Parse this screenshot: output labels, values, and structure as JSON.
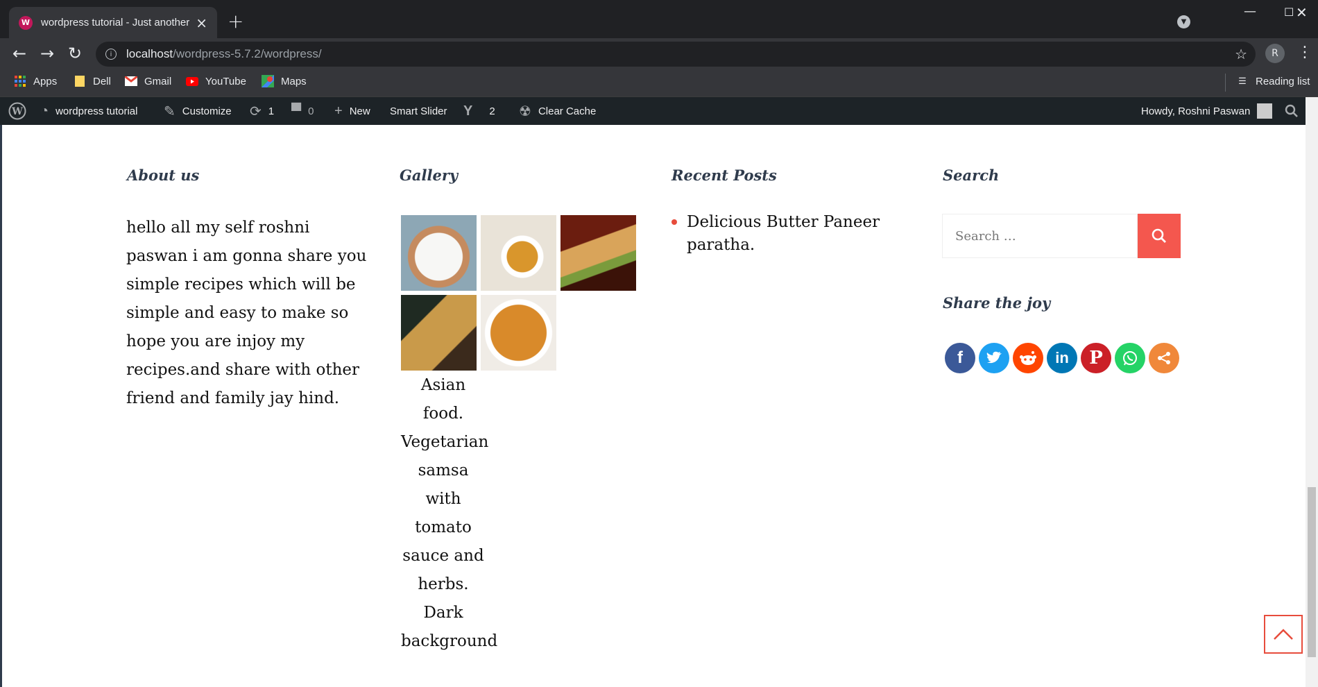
{
  "browser": {
    "tab_title": "wordpress tutorial - Just another",
    "url_host": "localhost",
    "url_path": "/wordpress-5.7.2/wordpress/",
    "profile_initial": "R",
    "bookmarks": [
      "Apps",
      "Dell",
      "Gmail",
      "YouTube",
      "Maps"
    ],
    "reading_list": "Reading list"
  },
  "adminbar": {
    "site_name": "wordpress tutorial",
    "customize": "Customize",
    "updates_count": "1",
    "comments_count": "0",
    "new": "New",
    "smart_slider": "Smart Slider",
    "yoast_count": "2",
    "clear_cache": "Clear Cache",
    "howdy": "Howdy, Roshni Paswan"
  },
  "widgets": {
    "about_title": "About us",
    "about_text": "hello all my self roshni paswan i am gonna share you simple recipes which will be simple and easy to make so hope you are injoy my recipes.and share with other friend and family jay hind.",
    "gallery_title": "Gallery",
    "gallery_caption": "Asian food. Vegetarian samsa with tomato sauce and herbs. Dark background",
    "recent_title": "Recent Posts",
    "recent_posts": [
      "Delicious Butter Paneer paratha."
    ],
    "search_title": "Search",
    "search_placeholder": "Search …",
    "share_title": "Share the joy"
  },
  "colors": {
    "accent": "#f4574e",
    "admin_bar": "#1d2327",
    "chrome_dark": "#202124"
  },
  "share_icons": [
    "facebook-icon",
    "twitter-icon",
    "reddit-icon",
    "linkedin-icon",
    "pinterest-icon",
    "whatsapp-icon",
    "share-icon"
  ]
}
